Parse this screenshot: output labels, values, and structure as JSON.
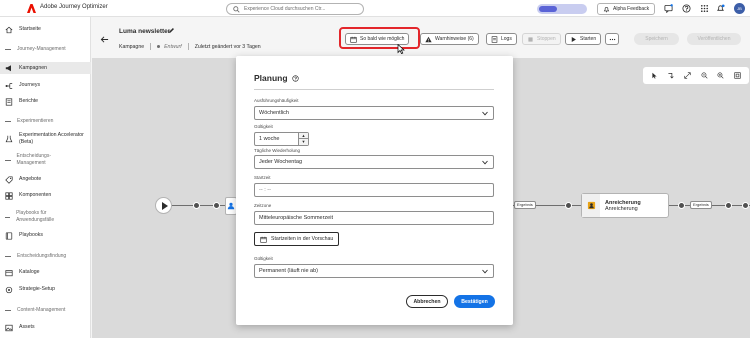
{
  "topbar": {
    "app_title": "Adobe Journey Optimizer",
    "search_placeholder": "Experience Cloud durchsuchen (Ctrl+/)",
    "search_display": "Experience Cloud durchsuchen Ctr...",
    "feedback_label": "Alpha Feedback",
    "avatar_initials": "JB"
  },
  "sidebar": {
    "items": [
      {
        "label": "Startseite",
        "icon": "home-icon"
      },
      {
        "section": "Journey-Management"
      },
      {
        "label": "Kampagnen",
        "icon": "megaphone-icon",
        "active": true
      },
      {
        "label": "Journeys",
        "icon": "journey-icon"
      },
      {
        "label": "Berichte",
        "icon": "report-icon"
      },
      {
        "section": "Experimentieren"
      },
      {
        "label": "Experimentation Accelerator (Beta)",
        "icon": "beaker-icon"
      },
      {
        "section": "Entscheidungs-Management"
      },
      {
        "label": "Angebote",
        "icon": "offer-icon"
      },
      {
        "label": "Komponenten",
        "icon": "components-icon"
      },
      {
        "section": "Playbooks für Anwendungsfälle"
      },
      {
        "label": "Playbooks",
        "icon": "playbook-icon"
      },
      {
        "section": "Entscheidungsfindung"
      },
      {
        "label": "Kataloge",
        "icon": "catalog-icon"
      },
      {
        "label": "Strategie-Setup",
        "icon": "strategy-icon"
      },
      {
        "section": "Content-Management"
      },
      {
        "label": "Assets",
        "icon": "assets-icon"
      }
    ]
  },
  "header": {
    "campaign_title": "Luma newsletter",
    "type": "Kampagne",
    "status": "Entwurf",
    "modified": "Zuletzt geändert vor 3 Tagen",
    "schedule_button": "So bald wie möglich",
    "warnings_button": "Warnhinweise (6)",
    "logs_button": "Logs",
    "stop_button": "Stoppen",
    "start_button": "Starten",
    "save_button": "Speichern",
    "publish_button": "Veröffentlichen"
  },
  "canvas": {
    "tag_left": "Ergebnis",
    "tag_mid": "Ergebnis",
    "tag_right": "Ergebnis",
    "node_title": "Anreicherung",
    "node_subtitle": "Anreicherung"
  },
  "modal": {
    "title": "Planung",
    "frequency_label": "Ausführungshäufigkeit",
    "frequency_value": "Wöchentlich",
    "validity_label": "Gültigkeit",
    "validity_value": "1 woche",
    "daily_repeat_label": "Tägliche Wiederholung",
    "daily_repeat_value": "Jeder Wochentag",
    "start_time_label": "Startzeit",
    "start_time_placeholder": "-- : --",
    "timezone_label": "Zeitzone",
    "timezone_value": "Mitteleuropäische Sommerzeit",
    "preview_button": "Startzeiten in der Vorschau",
    "validity2_label": "Gültigkeit",
    "validity2_value": "Permanent (läuft nie ab)",
    "cancel_button": "Abbrechen",
    "confirm_button": "Bestätigen"
  },
  "colors": {
    "accent": "#1473e6",
    "highlight": "#e3262b",
    "brand": "#eb1000"
  }
}
